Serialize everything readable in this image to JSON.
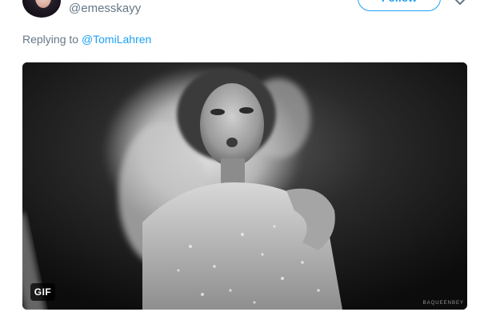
{
  "tweet": {
    "author": {
      "handle": "@emesskayy",
      "avatar": "avatar-photo"
    },
    "follow_label": "Follow",
    "menu_icon": "chevron-down-icon",
    "reply": {
      "prefix": "Replying to ",
      "mention": "@TomiLahren"
    },
    "media": {
      "type": "gif",
      "badge": "GIF",
      "watermark": "BAQUEENBEY",
      "tone": "black-and-white"
    }
  },
  "colors": {
    "accent": "#1da1f2",
    "secondary_text": "#657786",
    "background": "#ffffff"
  }
}
